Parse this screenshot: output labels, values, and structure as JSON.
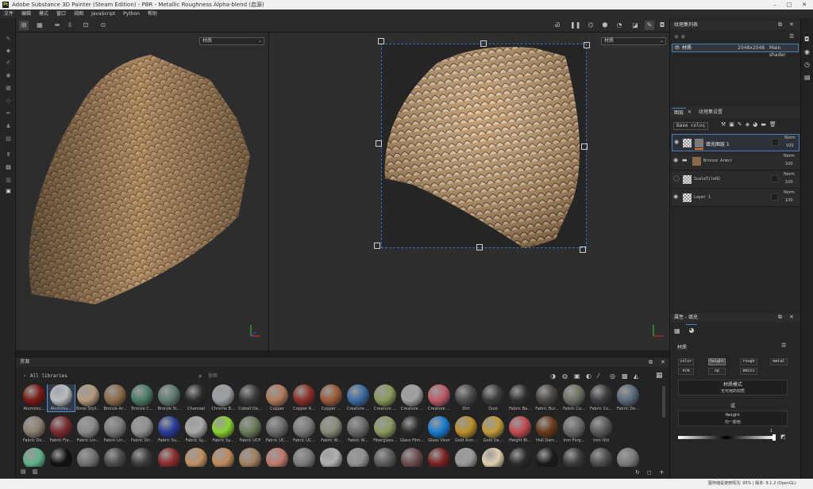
{
  "titlebar": {
    "title": "Adobe Substance 3D Painter (Steam Edition) - PBR - Metallic Roughness Alpha-blend (启源)"
  },
  "menu": [
    "文件",
    "编辑",
    "模式",
    "窗口",
    "视图",
    "JavaScript",
    "Python",
    "帮助"
  ],
  "viewport": {
    "left_channel": "材质",
    "right_channel": "材质"
  },
  "texture_set_list": {
    "title": "纹理集列表",
    "set_name": "材质",
    "resolution": "2048x2048",
    "shader": "Main shader"
  },
  "layers": {
    "tab_layers": "图层",
    "tab_settings": "纹理集设置",
    "channel": "Base color",
    "items": [
      {
        "name": "填充图层 1",
        "blend": "Norm",
        "opacity": "100"
      },
      {
        "name": "Bronze Armor",
        "blend": "Norm",
        "opacity": "100"
      },
      {
        "name": "ScaleTile02",
        "blend": "Norm",
        "opacity": "100"
      },
      {
        "name": "Layer 1",
        "blend": "Norm",
        "opacity": "100"
      }
    ]
  },
  "properties": {
    "title": "属性 - 填充",
    "section": "材质",
    "channels": [
      "color",
      "height",
      "rough",
      "metal",
      "nrm",
      "op",
      "emiss"
    ],
    "material_mode_label": "材质模式",
    "material_mode_value": "无可用的材质",
    "or_label": "或",
    "height_label": "Height",
    "height_value": "均一颜色",
    "slider_value": "1"
  },
  "assets": {
    "title": "资源",
    "library": "All libraries",
    "search_placeholder": "搜索",
    "row1": [
      "Aluminiu...",
      "Aluminiu...",
      "Bone Styli...",
      "Bronze Ar...",
      "Bronze C...",
      "Bronze St...",
      "Charcoal",
      "Chrome B...",
      "Cobalt Da...",
      "Copper",
      "Copper R...",
      "Copper ...",
      "Creature ...",
      "Creature ...",
      "Creature ...",
      "Creature ...",
      "Dirt",
      "Dust",
      "Fabric Ba...",
      "Fabric Bur...",
      "Fabric Ca...",
      "Fabric Co...",
      "Fabric De..."
    ],
    "row2": [
      "Fabric Do...",
      "Fabric Fla...",
      "Fabric Lin...",
      "Fabric Lin...",
      "Fabric Str...",
      "Fabric Su...",
      "Fabric Sy...",
      "Fabric Sy...",
      "Fabric UCP",
      "Fabric UC...",
      "Fabric UC...",
      "Fabric W...",
      "Fabric W...",
      "Fiberglass...",
      "Glass Film...",
      "Glass Visor",
      "Gold Arm...",
      "Gold Da...",
      "Height Bl...",
      "Hull Dam...",
      "Iron Forg...",
      "Iron Old"
    ],
    "row1_colors": [
      "#7a1a14",
      "#b9bcc0",
      "#b39a7c",
      "#8a6a4a",
      "#4c7a66",
      "#5d7a6e",
      "#2a2a2a",
      "#9a9ea4",
      "#3a3a3c",
      "#b07a5a",
      "#8a2e26",
      "#9a5a3a",
      "#3a6aa0",
      "#8a9a5a",
      "#a0a0a0",
      "#c05a6a",
      "#4a4a4a",
      "#3a3a3a",
      "#2e2e2e",
      "#4a4640",
      "#6a7060",
      "#3a3c40",
      "#5a6a7a"
    ],
    "row2_colors": [
      "#8a7e70",
      "#7a2a30",
      "#8a8a8a",
      "#7a7a7a",
      "#909090",
      "#2a3a9a",
      "#a8a8a8",
      "#8ad030",
      "#6a7a5a",
      "#6a6a6a",
      "#7a7a7a",
      "#8a8a7a",
      "#6a6a6a",
      "#8a9a60",
      "#2a2a2a",
      "#1a7ad0",
      "#b8902a",
      "#c09a3a",
      "#c04a50",
      "#6a3a1a",
      "#6a6a6a",
      "#5a5a5a"
    ],
    "row3_colors": [
      "#60b08a",
      "#101010",
      "#707070",
      "#4a4a4a",
      "#3a3a3a",
      "#8a2a2a",
      "#c09060",
      "#c08a5a",
      "#a08060",
      "#c07a6a",
      "#7a7a7a",
      "#b0b0b0",
      "#909090",
      "#5a5a5a",
      "#6a4a4a",
      "#7a2020",
      "#9a9a9a",
      "#e0d0b0",
      "#2a2a2a",
      "#1a1a1a",
      "#3a3a3a",
      "#4a4a4a",
      "#7a7a7a"
    ]
  },
  "status": {
    "text": "图存储是使用情况: 95% | 版本: 9.1.2 (OpenGL)"
  }
}
